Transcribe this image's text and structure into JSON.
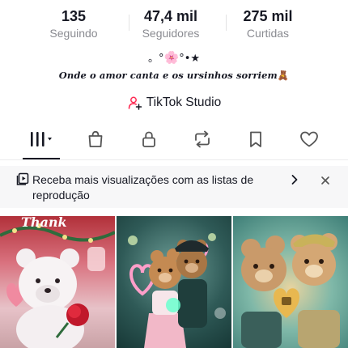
{
  "stats": [
    {
      "value": "135",
      "label": "Seguindo"
    },
    {
      "value": "47,4 mil",
      "label": "Seguidores"
    },
    {
      "value": "275 mil",
      "label": "Curtidas"
    }
  ],
  "bio": {
    "decoration_left": "。°",
    "decoration_flower": "🌸",
    "decoration_right": "°•★",
    "line": "Onde o amor canta e os ursinhos sorriem",
    "line_emoji": "🧸"
  },
  "studio": {
    "label": "TikTok Studio",
    "icon": "person-plus-icon"
  },
  "tabs": [
    {
      "name": "grid",
      "icon": "grid-bars-icon"
    },
    {
      "name": "shop",
      "icon": "shopping-bag-icon"
    },
    {
      "name": "private",
      "icon": "lock-icon"
    },
    {
      "name": "reposts",
      "icon": "repost-icon"
    },
    {
      "name": "favorites",
      "icon": "bookmark-icon"
    },
    {
      "name": "liked",
      "icon": "heart-icon"
    }
  ],
  "banner": {
    "text": "Receba mais visualizações com as listas de reprodução",
    "icon": "playlist-icon"
  },
  "thumbnail_overlay_text": "Thank",
  "colors": {
    "text": "#161823",
    "secondary": "#8a8b91",
    "studio_icon": "#fe2c55",
    "banner_bg": "#f7f7f8"
  }
}
